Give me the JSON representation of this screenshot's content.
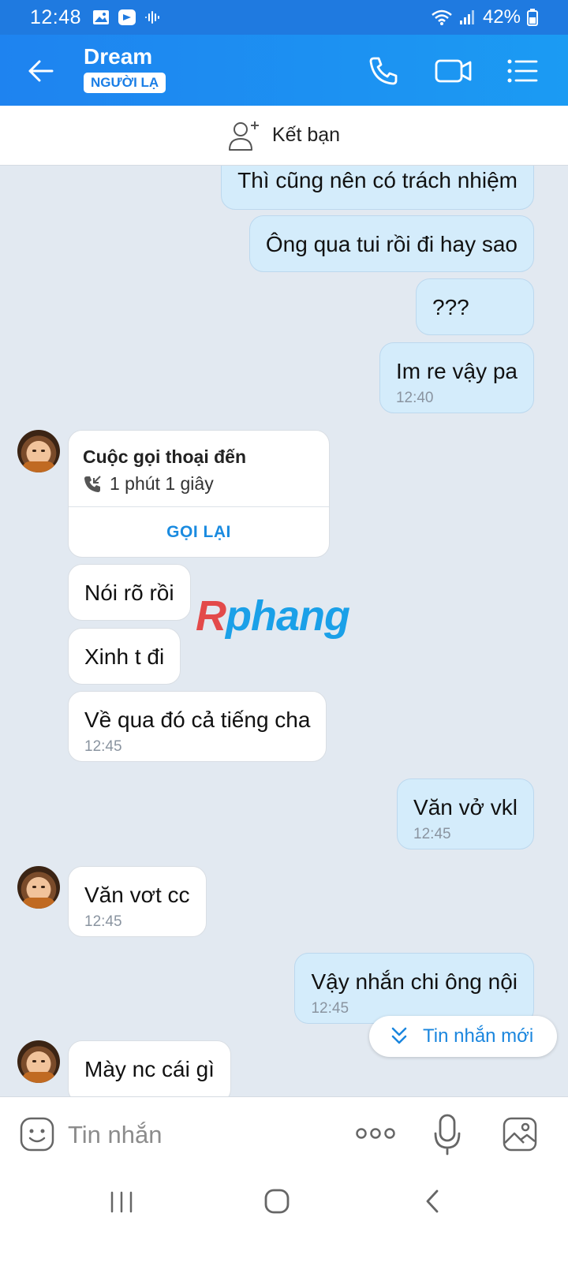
{
  "status": {
    "time": "12:48",
    "battery": "42%"
  },
  "header": {
    "name": "Dream",
    "badge": "NGƯỜI LẠ"
  },
  "friend_bar": {
    "label": "Kết bạn"
  },
  "messages": [
    {
      "dir": "out",
      "text": "Thì cũng nên có trách nhiệm"
    },
    {
      "dir": "out",
      "text": "Ông qua tui rồi đi hay sao"
    },
    {
      "dir": "out",
      "text": "???"
    },
    {
      "dir": "out",
      "text": "Im re vậy pa",
      "time": "12:40"
    },
    {
      "dir": "in",
      "text": "Nói rõ rồi"
    },
    {
      "dir": "in",
      "text": "Xinh t đi"
    },
    {
      "dir": "in",
      "text": "Về qua đó cả tiếng cha",
      "time": "12:45"
    },
    {
      "dir": "out",
      "text": "Văn vở vkl",
      "time": "12:45"
    },
    {
      "dir": "in",
      "text": "Văn vơt cc",
      "time": "12:45"
    },
    {
      "dir": "out",
      "text": "Vậy nhắn chi ông nội",
      "time": "12:45"
    },
    {
      "dir": "in",
      "text": "Mày nc cái gì"
    }
  ],
  "call_card": {
    "title": "Cuộc gọi thoại đến",
    "duration": "1 phút 1 giây",
    "action": "GỌI LẠI"
  },
  "watermark": {
    "first": "R",
    "rest": "phang"
  },
  "new_messages": {
    "label": "Tin nhắn mới"
  },
  "composer": {
    "placeholder": "Tin nhắn"
  },
  "icons": {
    "back": "arrow-left-icon",
    "call": "phone-icon",
    "video": "video-icon",
    "menu": "list-menu-icon",
    "add_friend": "add-person-icon",
    "emoji": "emoji-icon",
    "more": "more-dots-icon",
    "mic": "microphone-icon",
    "image": "image-icon"
  },
  "colors": {
    "header": "#1e83f0",
    "outgoing_bubble": "#d4ecfb",
    "incoming_bubble": "#ffffff",
    "chat_bg": "#e2e9f1",
    "accent": "#1a8be0"
  }
}
